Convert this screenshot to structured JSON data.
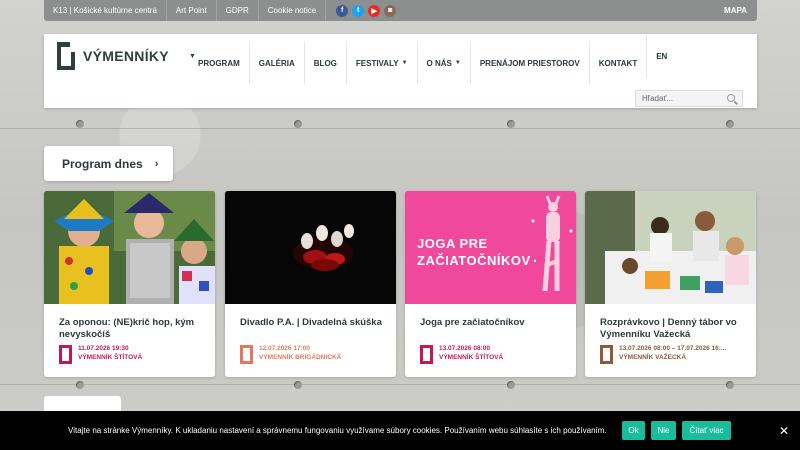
{
  "topbar": {
    "links": [
      "K13 | Košické kultúrne centrá",
      "Art Point",
      "GDPR",
      "Cookie notice"
    ],
    "social": [
      {
        "icon": "facebook-icon",
        "glyph": "f",
        "color": "#3b5998"
      },
      {
        "icon": "twitter-icon",
        "glyph": "t",
        "color": "#1da1f2"
      },
      {
        "icon": "youtube-icon",
        "glyph": "▶",
        "color": "#e52d27"
      },
      {
        "icon": "instagram-icon",
        "glyph": "◙",
        "color": "#8a6a55"
      }
    ],
    "mapa": "MAPA"
  },
  "header": {
    "logo_text": "VÝMENNÍKY",
    "nav": [
      {
        "label": "PROGRAM",
        "dropdown": false
      },
      {
        "label": "GALÉRIA",
        "dropdown": false
      },
      {
        "label": "BLOG",
        "dropdown": false
      },
      {
        "label": "FESTIVALY",
        "dropdown": true
      },
      {
        "label": "O NÁS",
        "dropdown": true
      },
      {
        "label": "PRENÁJOM PRIESTOROV",
        "dropdown": false
      },
      {
        "label": "KONTAKT",
        "dropdown": false
      },
      {
        "label": "EN",
        "dropdown": false
      }
    ],
    "search_placeholder": "Hľadať..."
  },
  "program_button": {
    "label": "Program dnes",
    "chevron": "›"
  },
  "cards": [
    {
      "title": "Za oponou: (NE)krič hop, kým nevyskočíš",
      "date": "11.07.2026 19:30",
      "venue": "VÝMENNÍK ŠTÍTOVÁ",
      "accent": "#c2185b"
    },
    {
      "title": "Divadlo P.A. | Divadelná skúška",
      "date": "12.07.2026 17:00",
      "venue": "VÝMENNÍK BRIGÁDNICKÁ",
      "accent": "#e07a5f"
    },
    {
      "title": "Joga pre začiatočníkov",
      "date": "13.07.2026 08:00",
      "venue": "VÝMENNÍK ŠTÍTOVÁ",
      "accent": "#c2185b",
      "image_text": "JOGA PRE ZAČIATOČNÍKOV"
    },
    {
      "title": "Rozprávkovo | Denný tábor vo Výmenníku Važecká",
      "date": "13.07.2026 08:00 – 17.07.2026 16:...",
      "venue": "VÝMENNÍK VAŽECKÁ",
      "accent": "#8d5a3b"
    }
  ],
  "cookie": {
    "text": "Vitajte na stránke Výmenníky. K ukladaniu nastavení a správnemu fungovaniu využívame súbory cookies. Používaním webu súhlasíte s ich používaním.",
    "ok": "Ok",
    "no": "Nie",
    "more": "Čítať viac",
    "close": "✕"
  }
}
